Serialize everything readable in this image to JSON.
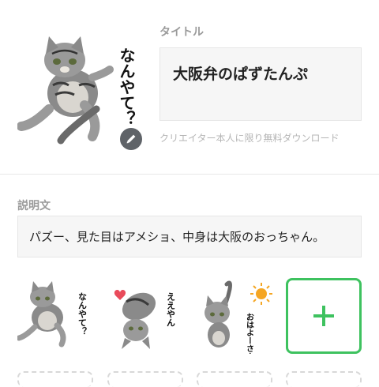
{
  "main_sticker": {
    "caption": "なんやて？",
    "edit_icon": "pencil-icon"
  },
  "title": {
    "label": "タイトル",
    "value": "大阪弁のぱずたんぷ",
    "hint": "クリエイター本人に限り無料ダウンロード"
  },
  "description": {
    "label": "説明文",
    "value": "パズー、見た目はアメショ、中身は大阪のおっちゃん。"
  },
  "stickers": [
    {
      "caption": "なんやて？"
    },
    {
      "caption": "ええやん"
    },
    {
      "caption": "おはよーさん"
    }
  ],
  "add_button": {
    "icon": "plus-icon"
  },
  "colors": {
    "accent": "#3ec25f",
    "label": "#9a9a9a",
    "field_bg": "#f6f6f6"
  }
}
